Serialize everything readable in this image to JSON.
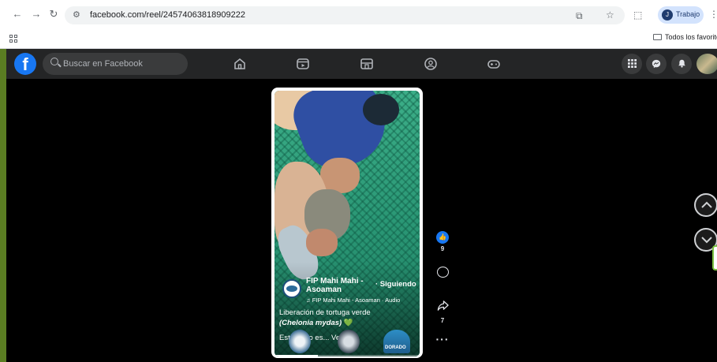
{
  "browser": {
    "url": "facebook.com/reel/24574063818909222",
    "profile_initial": "J",
    "profile_name": "Trabajo",
    "bookmarks_label": "Todos los favoritos"
  },
  "facebook": {
    "brand_color": "#1877f2",
    "search_placeholder": "Buscar en Facebook"
  },
  "reel": {
    "page_name": "FIP Mahi Mahi - Asoaman",
    "follow_status": "· Siguiendo",
    "audio": "FIP Mahi Mahi - Asoaman · Audio",
    "caption_line1": "Liberación de tortuga verde",
    "caption_line2": "(Chelonia mydas)",
    "caption_emoji": "💚",
    "caption_more": "Este logro es... Ver más",
    "watermark": "DORADO",
    "progress": 0.3,
    "likes": "9",
    "shares": "7",
    "more_label": "···"
  }
}
